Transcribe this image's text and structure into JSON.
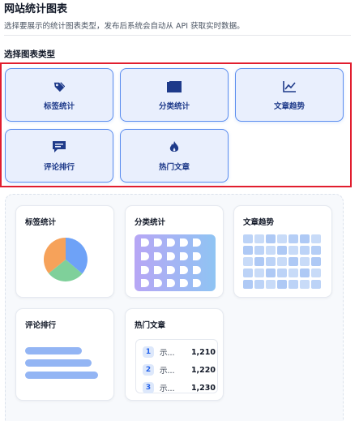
{
  "header": {
    "title": "网站统计图表",
    "description": "选择要展示的统计图表类型，发布后系统会自动从 API 获取实时数据。",
    "section_title": "选择图表类型"
  },
  "chart_types": [
    {
      "label": "标签统计",
      "icon": "tag-icon"
    },
    {
      "label": "分类统计",
      "icon": "folder-icon"
    },
    {
      "label": "文章趋势",
      "icon": "line-chart-icon"
    },
    {
      "label": "评论排行",
      "icon": "comment-icon"
    },
    {
      "label": "热门文章",
      "icon": "fire-icon"
    }
  ],
  "previews": {
    "tag": {
      "title": "标签统计"
    },
    "category": {
      "title": "分类统计"
    },
    "trend": {
      "title": "文章趋势"
    },
    "comments": {
      "title": "评论排行"
    },
    "hot": {
      "title": "热门文章",
      "rows": [
        {
          "rank": "1",
          "name": "示...",
          "value": "1,210"
        },
        {
          "rank": "2",
          "name": "示...",
          "value": "1,220"
        },
        {
          "rank": "3",
          "name": "示...",
          "value": "1,230"
        }
      ]
    }
  },
  "colors": {
    "accent": "#5b8def",
    "selected_frame": "#e11d2e",
    "pie": [
      "#6ea2f7",
      "#7fd09a",
      "#f6a25a"
    ]
  }
}
